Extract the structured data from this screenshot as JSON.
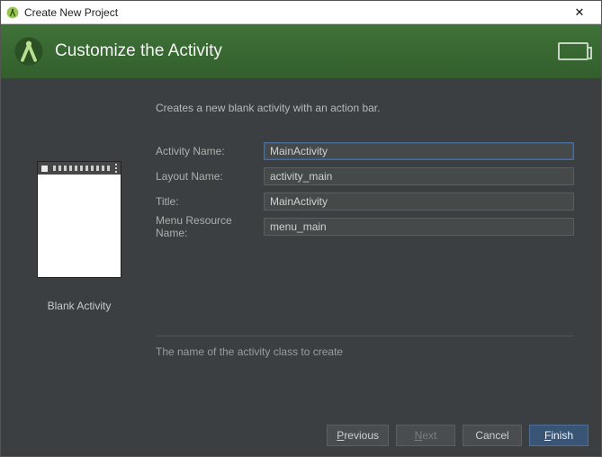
{
  "window": {
    "title": "Create New Project"
  },
  "header": {
    "heading": "Customize the Activity"
  },
  "main": {
    "description": "Creates a new blank activity with an action bar.",
    "preview_caption": "Blank Activity",
    "fields": {
      "activity_name": {
        "label": "Activity Name:",
        "value": "MainActivity"
      },
      "layout_name": {
        "label": "Layout Name:",
        "value": "activity_main"
      },
      "title": {
        "label": "Title:",
        "value": "MainActivity"
      },
      "menu_resource": {
        "label": "Menu Resource Name:",
        "value": "menu_main"
      }
    },
    "hint": "The name of the activity class to create"
  },
  "footer": {
    "previous": "Previous",
    "next": "Next",
    "cancel": "Cancel",
    "finish": "Finish"
  }
}
